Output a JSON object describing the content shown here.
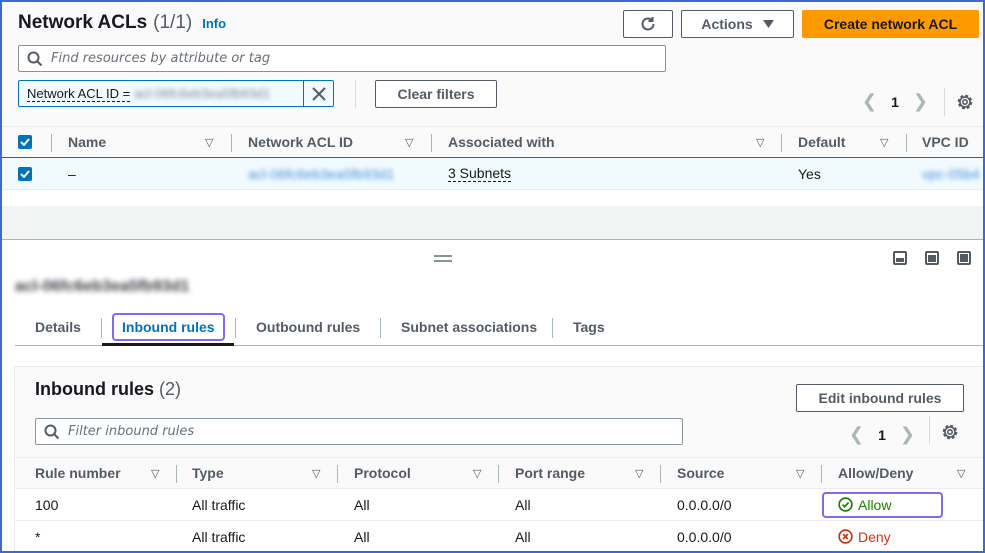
{
  "header": {
    "title": "Network ACLs",
    "count": "(1/1)",
    "info": "Info",
    "refresh_icon": "refresh-icon",
    "actions_label": "Actions",
    "create_label": "Create network ACL"
  },
  "search": {
    "placeholder": "Find resources by attribute or tag"
  },
  "filter_token": {
    "key": "Network ACL ID =",
    "value": "acl-06fc6eb3ea5fb93d1"
  },
  "clear_filters_label": "Clear filters",
  "pagination_top": {
    "page": "1"
  },
  "acl_table": {
    "columns": [
      "Name",
      "Network ACL ID",
      "Associated with",
      "Default",
      "VPC ID"
    ],
    "rows": [
      {
        "selected": true,
        "name": "–",
        "acl_id": "acl-06fc6eb3ea5fb93d1",
        "associated_with": "3 Subnets",
        "default": "Yes",
        "vpc_id": "vpc-05b4"
      }
    ]
  },
  "details": {
    "resource_id": "acl-06fc6eb3ea5fb93d1",
    "tabs": [
      {
        "label": "Details",
        "active": false
      },
      {
        "label": "Inbound rules",
        "active": true
      },
      {
        "label": "Outbound rules",
        "active": false
      },
      {
        "label": "Subnet associations",
        "active": false
      },
      {
        "label": "Tags",
        "active": false
      }
    ]
  },
  "inbound": {
    "title": "Inbound rules",
    "count": "(2)",
    "edit_label": "Edit inbound rules",
    "filter_placeholder": "Filter inbound rules",
    "page": "1",
    "columns": [
      "Rule number",
      "Type",
      "Protocol",
      "Port range",
      "Source",
      "Allow/Deny"
    ],
    "rows": [
      {
        "rule_number": "100",
        "type": "All traffic",
        "protocol": "All",
        "port_range": "All",
        "source": "0.0.0.0/0",
        "action": "Allow"
      },
      {
        "rule_number": "*",
        "type": "All traffic",
        "protocol": "All",
        "port_range": "All",
        "source": "0.0.0.0/0",
        "action": "Deny"
      }
    ]
  },
  "colors": {
    "primary_button": "#ff9900",
    "link": "#0073bb",
    "allow": "#1d8102",
    "deny": "#d13212",
    "focus_ring": "#7c6df0"
  }
}
